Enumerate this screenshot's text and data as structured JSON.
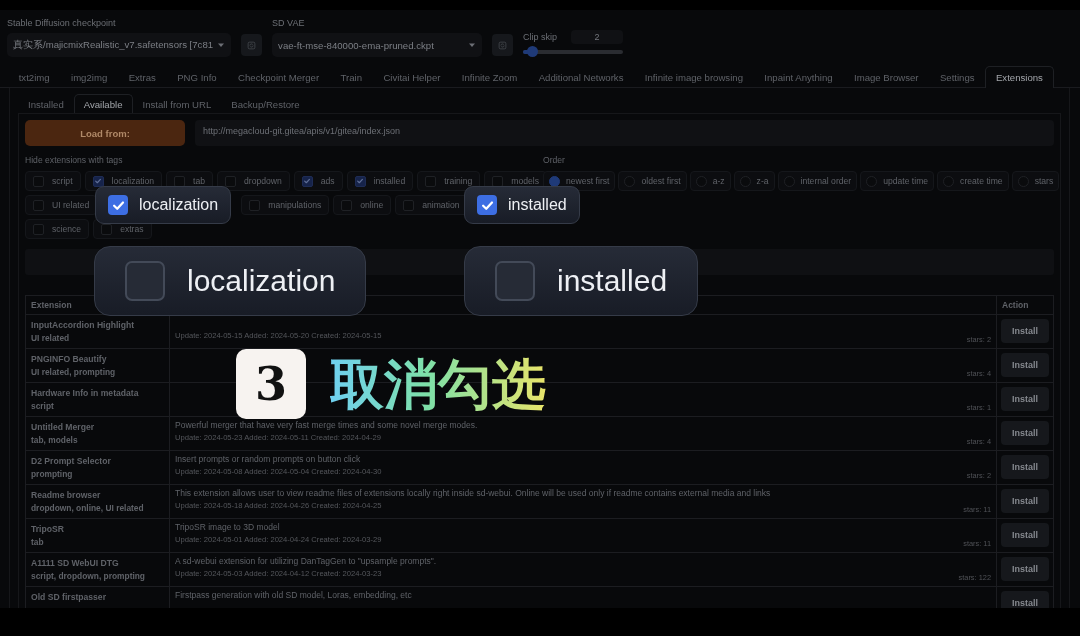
{
  "settings": {
    "checkpoint": {
      "label": "Stable Diffusion checkpoint",
      "value": "真实系/majicmixRealistic_v7.safetensors [7c81"
    },
    "vae": {
      "label": "SD VAE",
      "value": "vae-ft-mse-840000-ema-pruned.ckpt"
    },
    "clip_skip": {
      "label": "Clip skip",
      "value": "2",
      "level": 0.09
    }
  },
  "main_tabs": [
    {
      "label": "txt2img",
      "selected": false
    },
    {
      "label": "img2img",
      "selected": false
    },
    {
      "label": "Extras",
      "selected": false
    },
    {
      "label": "PNG Info",
      "selected": false
    },
    {
      "label": "Checkpoint Merger",
      "selected": false
    },
    {
      "label": "Train",
      "selected": false
    },
    {
      "label": "Civitai Helper",
      "selected": false
    },
    {
      "label": "Infinite Zoom",
      "selected": false
    },
    {
      "label": "Additional Networks",
      "selected": false
    },
    {
      "label": "Infinite image browsing",
      "selected": false
    },
    {
      "label": "Inpaint Anything",
      "selected": false
    },
    {
      "label": "Image Browser",
      "selected": false
    },
    {
      "label": "Settings",
      "selected": false
    },
    {
      "label": "Extensions",
      "selected": true
    }
  ],
  "sub_tabs": [
    {
      "label": "Installed",
      "selected": false
    },
    {
      "label": "Available",
      "selected": true
    },
    {
      "label": "Install from URL",
      "selected": false
    },
    {
      "label": "Backup/Restore",
      "selected": false
    }
  ],
  "load_button": "Load from:",
  "url_field": {
    "value": "http://megacloud-git.gitea/apis/v1/gitea/index.json"
  },
  "hide_tags": {
    "label": "Hide extensions with tags",
    "rows": [
      [
        {
          "label": "script",
          "checked": false
        },
        {
          "label": "localization",
          "checked": true
        },
        {
          "label": "tab",
          "checked": false
        },
        {
          "label": "dropdown",
          "checked": false
        },
        {
          "label": "ads",
          "checked": true
        },
        {
          "label": "installed",
          "checked": true
        },
        {
          "label": "training",
          "checked": false
        },
        {
          "label": "models",
          "checked": false
        }
      ],
      [
        {
          "label": "UI related",
          "checked": false
        },
        {
          "label": "manipulations",
          "checked": false
        },
        {
          "label": "online",
          "checked": false
        },
        {
          "label": "animation",
          "checked": false
        }
      ],
      [
        {
          "label": "science",
          "checked": false
        },
        {
          "label": "extras",
          "checked": false
        }
      ]
    ]
  },
  "order": {
    "label": "Order",
    "options": [
      {
        "label": "newest first",
        "selected": true
      },
      {
        "label": "oldest first",
        "selected": false
      },
      {
        "label": "a-z",
        "selected": false
      },
      {
        "label": "z-a",
        "selected": false
      },
      {
        "label": "internal order",
        "selected": false
      },
      {
        "label": "update time",
        "selected": false
      },
      {
        "label": "create time",
        "selected": false
      },
      {
        "label": "stars",
        "selected": false
      }
    ]
  },
  "table": {
    "columns": [
      "Extension",
      "Action"
    ],
    "rows": [
      {
        "name": "InputAccordion Highlight",
        "tags": "UI related",
        "dates": "Update: 2024-05-15 Added: 2024-05-20 Created: 2024-05-15",
        "stars": "stars: 2",
        "action": "Install"
      },
      {
        "name": "PNGINFO Beautify",
        "tags": "UI related, prompting",
        "stars": "stars: 4",
        "action": "Install"
      },
      {
        "name": "Hardware Info in metadata",
        "tags": "script",
        "stars": "stars: 1",
        "action": "Install"
      },
      {
        "name": "Untitled Merger",
        "tags": "tab, models",
        "description": "Powerful merger that have very fast merge times and some novel merge modes.",
        "dates": "Update: 2024-05-23 Added: 2024-05-11 Created: 2024-04-29",
        "stars": "stars: 4",
        "action": "Install"
      },
      {
        "name": "D2 Prompt Selector",
        "tags": "prompting",
        "description": "Insert prompts or random prompts on button click",
        "dates": "Update: 2024-05-08 Added: 2024-05-04 Created: 2024-04-30",
        "stars": "stars: 2",
        "action": "Install"
      },
      {
        "name": "Readme browser",
        "tags": "dropdown, online, UI related",
        "description": "This extension allows user to view readme files of extensions locally right inside sd-webui. Online will be used only if readme contains external media and links",
        "dates": "Update: 2024-05-18 Added: 2024-04-26 Created: 2024-04-25",
        "stars": "stars: 11",
        "action": "Install"
      },
      {
        "name": "TripoSR",
        "tags": "tab",
        "description": "TripoSR image to 3D model",
        "dates": "Update: 2024-05-01 Added: 2024-04-24 Created: 2024-03-29",
        "stars": "stars: 11",
        "action": "Install"
      },
      {
        "name": "A1111 SD WebUI DTG",
        "tags": "script, dropdown, prompting",
        "description": "A sd-webui extension for utilizing DanTagGen to \"upsample prompts\".",
        "dates": "Update: 2024-05-03 Added: 2024-04-12 Created: 2024-03-23",
        "stars": "stars: 122",
        "action": "Install"
      },
      {
        "name": "Old SD firstpasser",
        "description": "Firstpass generation with old SD model, Loras, embedding, etc",
        "action": "Install"
      }
    ]
  },
  "callouts": {
    "checked": [
      {
        "label": "localization",
        "checked": true
      },
      {
        "label": "installed",
        "checked": true
      }
    ],
    "unchecked": [
      {
        "label": "localization",
        "checked": false
      },
      {
        "label": "installed",
        "checked": false
      }
    ],
    "step": {
      "number": "3",
      "text": "取消勾选"
    }
  }
}
